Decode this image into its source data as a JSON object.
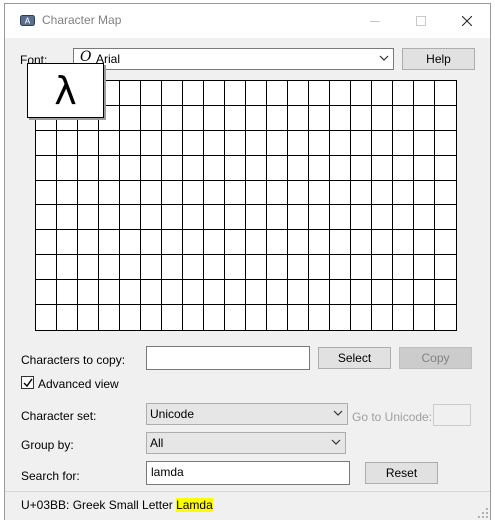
{
  "window": {
    "title": "Character Map"
  },
  "font": {
    "label": "Font:",
    "glyph": "O",
    "value": "Arial",
    "help_label": "Help"
  },
  "grid": {
    "columns": 20,
    "rows": 10,
    "zoom_char": "λ"
  },
  "copy_row": {
    "label": "Characters to copy:",
    "value": "",
    "select_label": "Select",
    "copy_label": "Copy"
  },
  "advanced": {
    "label": "Advanced view",
    "checked": true
  },
  "charset": {
    "label": "Character set:",
    "value": "Unicode",
    "goto_label": "Go to Unicode:",
    "goto_value": ""
  },
  "groupby": {
    "label": "Group by:",
    "value": "All"
  },
  "search": {
    "label": "Search for:",
    "value": "lamda",
    "reset_label": "Reset"
  },
  "status": {
    "prefix": "U+03BB: Greek Small Letter ",
    "highlight": "Lamda"
  }
}
